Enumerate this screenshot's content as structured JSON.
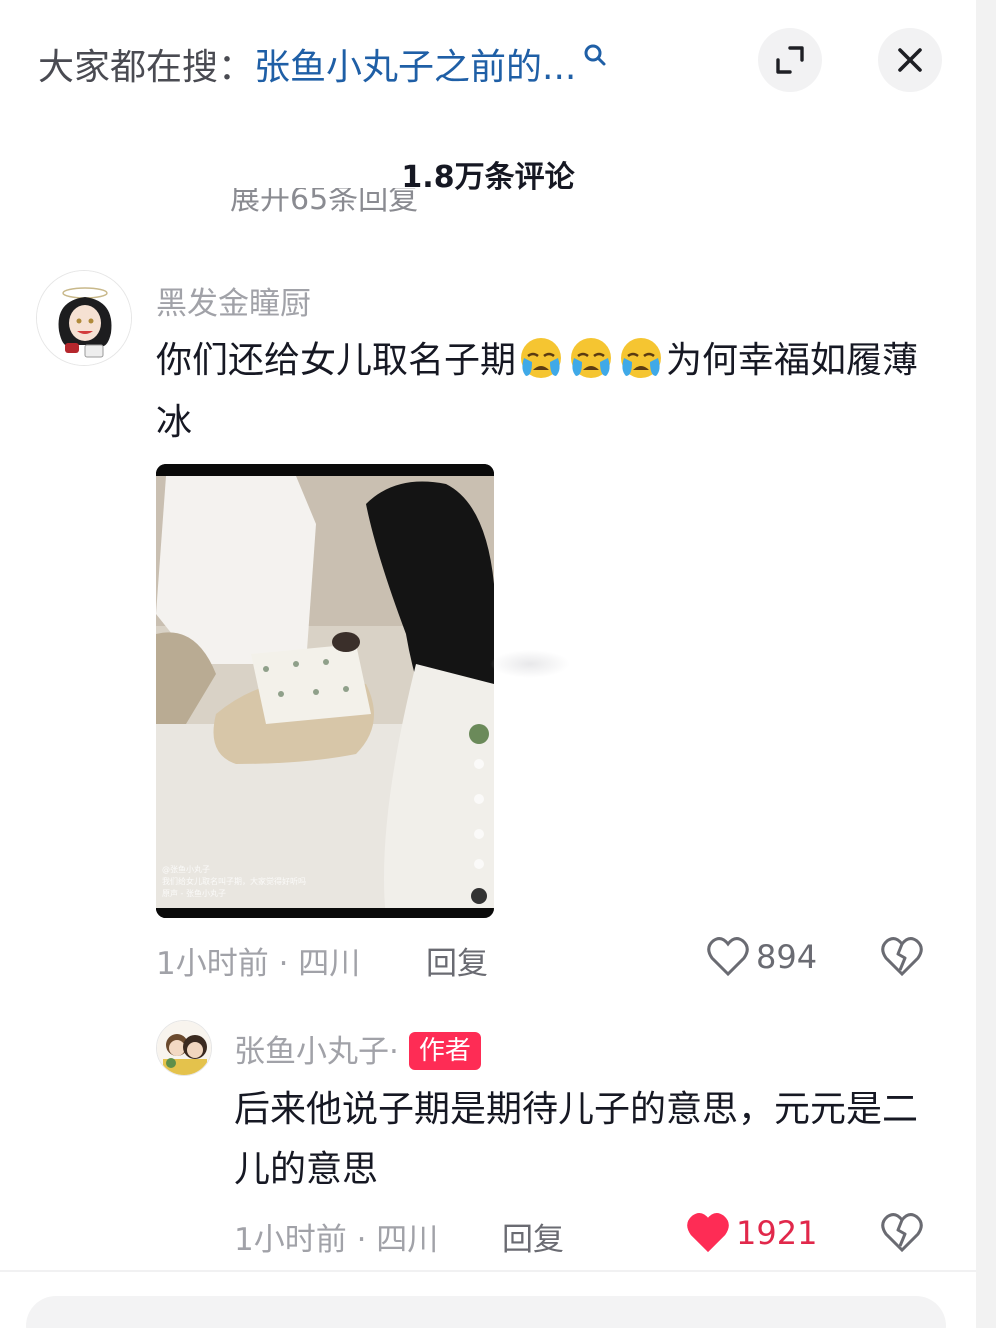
{
  "search": {
    "prefix": "大家都在搜：",
    "query": "张鱼小丸子之前的...",
    "icon": "search-icon"
  },
  "header": {
    "expand_icon": "expand-icon",
    "close_icon": "close-icon",
    "comment_count": "1.8万条评论",
    "cutoff_text": "展开65条回复"
  },
  "comments": [
    {
      "username": "黑发金瞳厨",
      "text_before": "你们还给女儿取名子期",
      "emoji": "crying-emoji",
      "emoji_count": 3,
      "text_after": "为何幸福如履薄冰",
      "time_location": "1小时前 · 四川",
      "reply_label": "回复",
      "likes": "894",
      "liked": false,
      "video_caption_lines": [
        "@张鱼小丸子",
        "我们给女儿取名叫子期，大家觉得好听吗",
        "原声 - 张鱼小丸子"
      ]
    },
    {
      "username": "张鱼小丸子·",
      "badge": "作者",
      "text": "后来他说子期是期待儿子的意思，元元是二儿的意思",
      "time_location": "1小时前 · 四川",
      "reply_label": "回复",
      "likes": "1921",
      "liked": true
    }
  ],
  "colors": {
    "accent_red": "#fe2c55",
    "link_blue": "#1f5fa6",
    "muted_gray": "#a1a2a8"
  }
}
